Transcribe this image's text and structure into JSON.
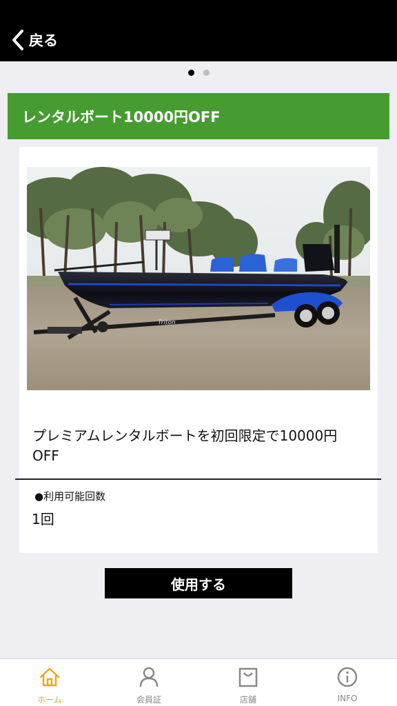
{
  "header": {
    "back_label": "戻る"
  },
  "carousel": {
    "total": 2,
    "active_index": 0
  },
  "coupon": {
    "title": "レンタルボート10000円OFF",
    "description": "プレミアムレンタルボートを初回限定で10000円OFF",
    "uses_label": "●利用可能回数",
    "uses_value": "1回",
    "use_button_label": "使用する",
    "boat_brand_text": "Triton"
  },
  "colors": {
    "header_green": "#479c31",
    "active_tab": "#f2a516",
    "inactive_tab": "#888888"
  },
  "tabbar": {
    "items": [
      {
        "label": "ホーム",
        "icon": "home-icon",
        "active": true
      },
      {
        "label": "会員証",
        "icon": "person-icon",
        "active": false
      },
      {
        "label": "店舗",
        "icon": "shopping-bag-icon",
        "active": false
      },
      {
        "label": "INFO",
        "icon": "info-icon",
        "active": false
      }
    ]
  }
}
